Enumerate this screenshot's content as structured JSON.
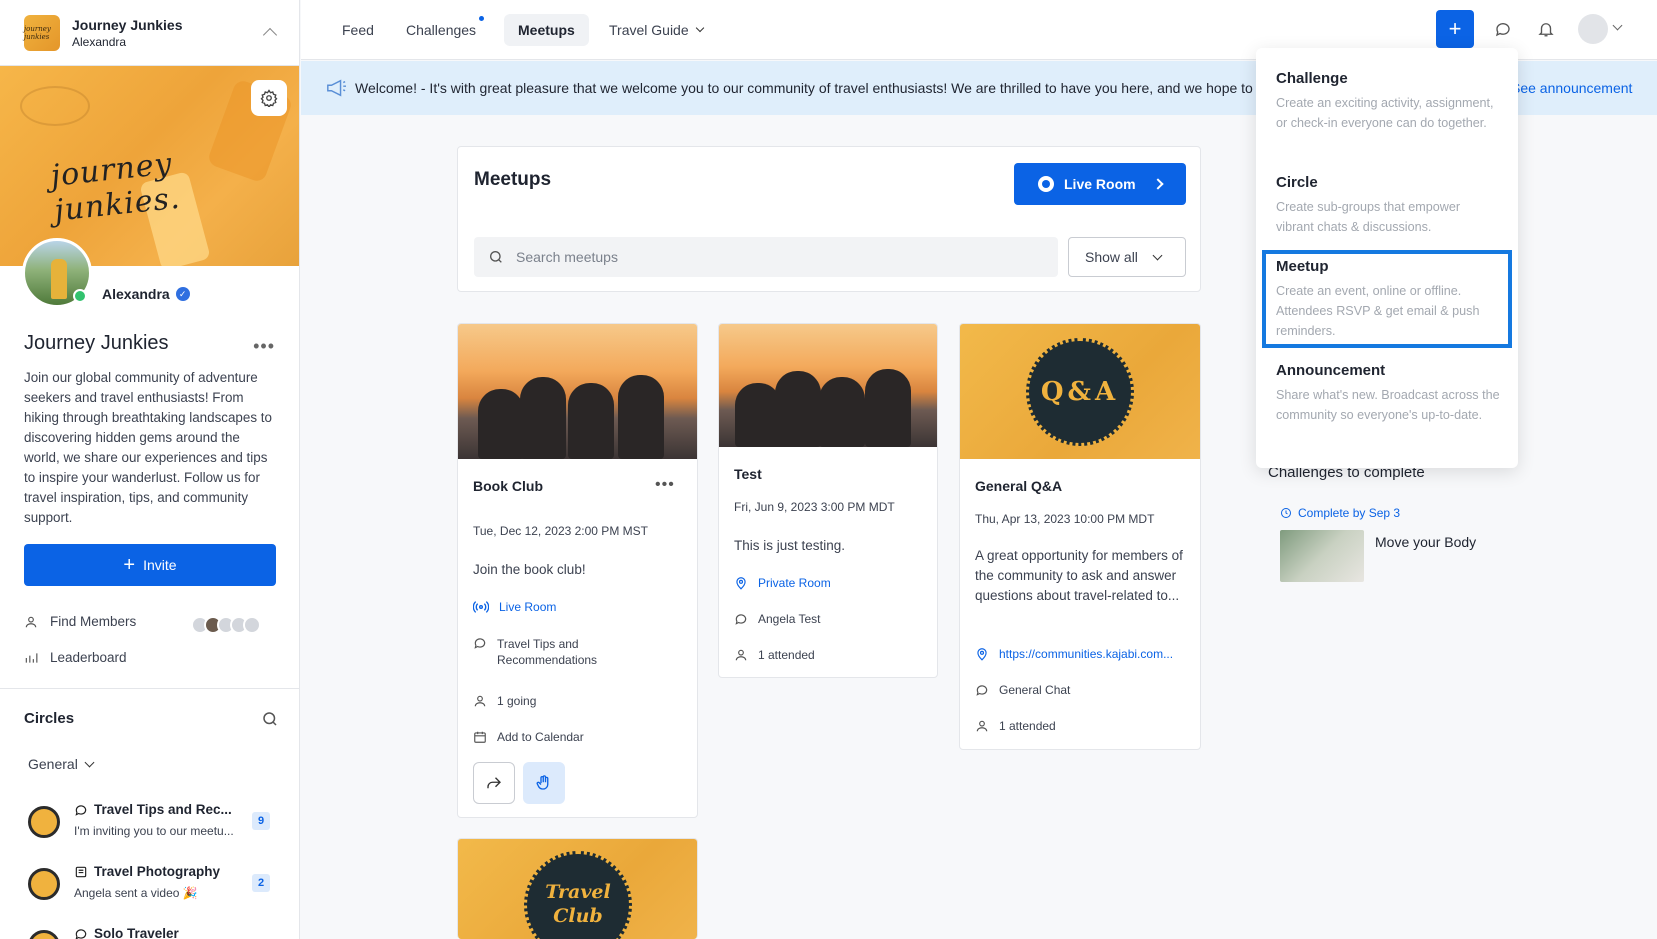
{
  "community": {
    "name": "Journey Junkies",
    "owner_short": "Alexandra",
    "logo_text": "journey junkies",
    "banner_script": "journey junkies.",
    "owner_name": "Alexandra",
    "title": "Journey Junkies",
    "description": "Join our global community of adventure seekers and travel enthusiasts! From hiking through breathtaking landscapes to discovering hidden gems around the world, we share our experiences and tips to inspire your wanderlust. Follow us for travel inspiration, tips, and community support.",
    "invite_label": "Invite",
    "find_members": "Find Members",
    "leaderboard": "Leaderboard"
  },
  "circles": {
    "header": "Circles",
    "filter": "General",
    "items": [
      {
        "title": "Travel Tips and Rec...",
        "subtitle": "I'm inviting you to our meetu...",
        "badge": "9"
      },
      {
        "title": "Travel Photography",
        "subtitle": "Angela sent a video 🎉",
        "badge": "2"
      },
      {
        "title": "Solo Traveler",
        "subtitle": "",
        "badge": ""
      }
    ]
  },
  "nav": {
    "tabs": [
      "Feed",
      "Challenges",
      "Meetups",
      "Travel Guide"
    ],
    "active": "Meetups"
  },
  "announcement": {
    "text": "Welcome! - It's with great pleasure that we welcome you to our community of travel enthusiasts! We are thrilled to have you here, and we hope to",
    "link": "See announcement"
  },
  "meetups": {
    "title": "Meetups",
    "live_room": "Live Room",
    "search_placeholder": "Search meetups",
    "filter": "Show all",
    "cards": [
      {
        "title": "Book Club",
        "date": "Tue, Dec 12, 2023 2:00 PM MST",
        "desc": "Join the book club!",
        "location": "Live Room",
        "circle": "Travel Tips and Recommendations",
        "attendance": "1 going",
        "calendar": "Add to Calendar"
      },
      {
        "title": "Test",
        "date": "Fri, Jun 9, 2023 3:00 PM MDT",
        "desc": "This is just testing.",
        "location": "Private Room",
        "circle": "Angela Test",
        "attendance": "1 attended"
      },
      {
        "title": "General Q&A",
        "image_text": "Q&A",
        "date": "Thu, Apr 13, 2023 10:00 PM MDT",
        "desc": "A great opportunity for members of the community to ask and answer questions about travel-related to...",
        "location": "https://communities.kajabi.com...",
        "circle": "General Chat",
        "attendance": "1 attended"
      },
      {
        "image_text_1": "Travel",
        "image_text_2": "Club"
      }
    ]
  },
  "create_menu": [
    {
      "title": "Challenge",
      "desc": "Create an exciting activity, assignment, or check-in everyone can do together."
    },
    {
      "title": "Circle",
      "desc": "Create sub-groups that empower vibrant chats & discussions."
    },
    {
      "title": "Meetup",
      "desc": "Create an event, online or offline. Attendees RSVP & get email & push reminders."
    },
    {
      "title": "Announcement",
      "desc": "Share what's new. Broadcast across the community so everyone's up-to-date."
    }
  ],
  "challenges": {
    "title": "Challenges to complete",
    "due": "Complete by Sep 3",
    "item": "Move your Body"
  },
  "colors": {
    "accent": "#0b63e5",
    "banner": "#f0b23e",
    "highlight": "#1579e0"
  }
}
